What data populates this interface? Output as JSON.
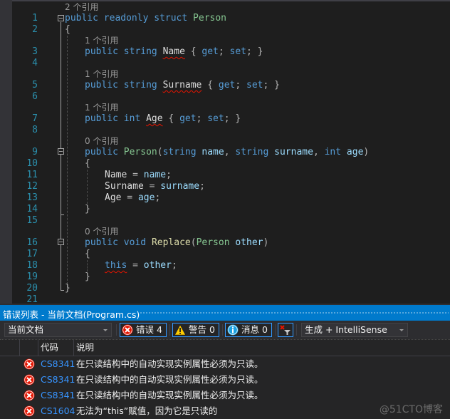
{
  "editor": {
    "lines": [
      {
        "num": "1",
        "lens": "2 个引用"
      },
      {
        "num": "2"
      },
      {
        "num": "3",
        "lens": "1 个引用"
      },
      {
        "num": "4"
      },
      {
        "num": "5",
        "lens": "1 个引用"
      },
      {
        "num": "6"
      },
      {
        "num": "7",
        "lens": "1 个引用"
      },
      {
        "num": "8"
      },
      {
        "num": "9",
        "lens": "0 个引用"
      },
      {
        "num": "10"
      },
      {
        "num": "11"
      },
      {
        "num": "12"
      },
      {
        "num": "13"
      },
      {
        "num": "14"
      },
      {
        "num": "15"
      },
      {
        "num": "16",
        "lens": "0 个引用"
      },
      {
        "num": "17"
      },
      {
        "num": "18"
      },
      {
        "num": "19"
      },
      {
        "num": "20"
      },
      {
        "num": "21"
      }
    ],
    "tokens": {
      "public": "public",
      "readonly": "readonly",
      "struct": "struct",
      "string": "string",
      "int": "int",
      "void": "void",
      "get": "get",
      "set": "set",
      "this": "this",
      "Person": "Person",
      "Name": "Name",
      "Surname": "Surname",
      "Age": "Age",
      "Replace": "Replace",
      "name": "name",
      "surname": "surname",
      "age": "age",
      "other": "other",
      "open_brace": "{",
      "close_brace": "}",
      "accessors_open": " { ",
      "semi": ";",
      "semi_space": "; ",
      "close_acc": "}",
      "eq": " = ",
      "lparen": "(",
      "rparen": ")",
      "comma": ", ",
      "space": " "
    }
  },
  "error_list": {
    "title": "错误列表 - 当前文档(Program.cs)",
    "scope_dropdown": "当前文档",
    "errors_button": {
      "label": "错误 4",
      "count": 4
    },
    "warnings_button": {
      "label": "警告 0",
      "count": 0
    },
    "messages_button": {
      "label": "消息 0",
      "count": 0
    },
    "build_dropdown": "生成 + IntelliSense",
    "columns": [
      "代码",
      "说明"
    ],
    "rows": [
      {
        "code": "CS8341",
        "description": "在只读结构中的自动实现实例属性必须为只读。"
      },
      {
        "code": "CS8341",
        "description": "在只读结构中的自动实现实例属性必须为只读。"
      },
      {
        "code": "CS8341",
        "description": "在只读结构中的自动实现实例属性必须为只读。"
      },
      {
        "code": "CS1604",
        "description": "无法为“this”赋值，因为它是只读的"
      }
    ]
  },
  "watermark": "@51CTO博客",
  "colors": {
    "accent": "#007acc",
    "error_red": "#e51400",
    "warning_yellow": "#ffcc00",
    "info_blue": "#1ba1e2",
    "code_link": "#3794ff"
  }
}
